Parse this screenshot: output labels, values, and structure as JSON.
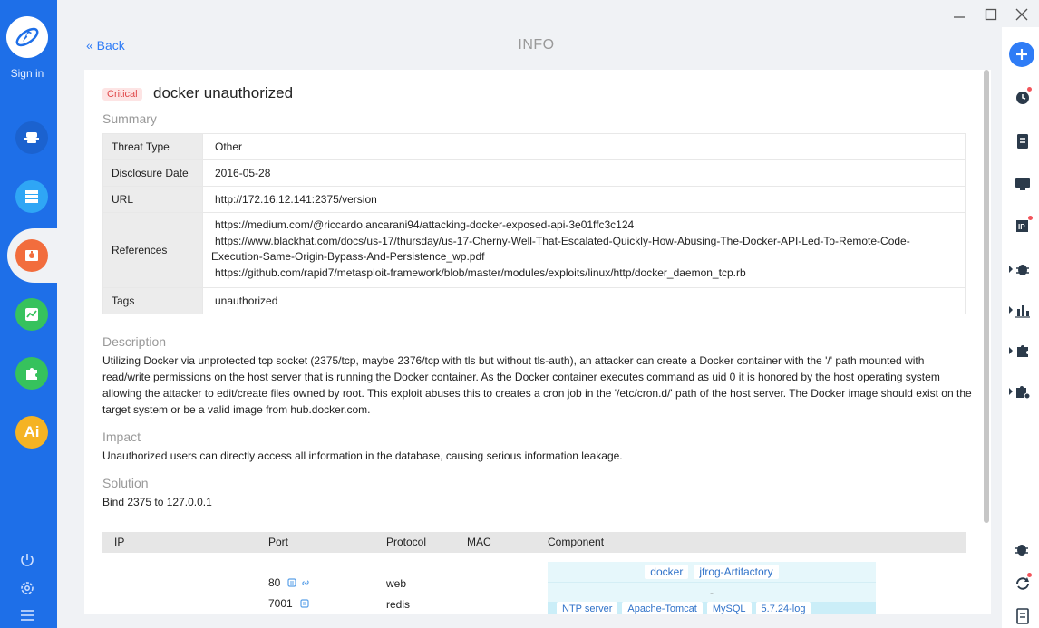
{
  "app": {
    "sign_in": "Sign in",
    "page_title": "INFO",
    "back_label": "« Back"
  },
  "colors": {
    "sidebar": "#1e6fe8",
    "accent": "#2f7cf6",
    "critical_text": "#e0484a",
    "critical_bg": "#fde4e4"
  },
  "sidebar": {
    "items": [
      {
        "icon": "hacker-icon",
        "color": "#1b62cf"
      },
      {
        "icon": "server-list-icon",
        "color": "#2fa6f5"
      },
      {
        "icon": "bug-report-icon",
        "color": "#f26d3d"
      },
      {
        "icon": "trend-chart-icon",
        "color": "#36c25d"
      },
      {
        "icon": "puzzle-icon",
        "color": "#36c25d"
      },
      {
        "icon": "ai-icon",
        "color": "#f5b324",
        "label": "Ai"
      }
    ],
    "bottom": [
      "power-icon",
      "settings-icon",
      "menu-icon"
    ]
  },
  "vuln": {
    "severity": "Critical",
    "title": "docker unauthorized",
    "summary_heading": "Summary",
    "fields": {
      "threat_type_label": "Threat Type",
      "threat_type": "Other",
      "disclosure_label": "Disclosure Date",
      "disclosure": "2016-05-28",
      "url_label": "URL",
      "url": "http://172.16.12.141:2375/version",
      "refs_label": "References",
      "ref1": "https://medium.com/@riccardo.ancarani94/attacking-docker-exposed-api-3e01ffc3c124",
      "ref2a": "https://www.blackhat.com/docs/us-17/thursday/us-17-Cherny-Well-That-Escalated-Quickly-How-Abusing-The-Docker-API-Led-To-Remote-Code-",
      "ref2b": "Execution-Same-Origin-Bypass-And-Persistence_wp.pdf",
      "ref3": "https://github.com/rapid7/metasploit-framework/blob/master/modules/exploits/linux/http/docker_daemon_tcp.rb",
      "tags_label": "Tags",
      "tags": "unauthorized"
    },
    "description_heading": "Description",
    "description": "Utilizing Docker via unprotected tcp socket (2375/tcp, maybe 2376/tcp with tls but without tls-auth), an attacker can create a Docker container with the '/' path mounted with read/write permissions on the host server that is running the Docker container. As the Docker container executes command as uid 0 it is honored by the host operating system allowing the attacker to edit/create files owned by root. This exploit abuses this to creates a cron job in the '/etc/cron.d/' path of the host server. The Docker image should exist on the target system or be a valid image from hub.docker.com.",
    "impact_heading": "Impact",
    "impact": "Unauthorized users can directly access all information in the database, causing serious information leakage.",
    "solution_heading": "Solution",
    "solution": "Bind 2375 to 127.0.0.1"
  },
  "assets": {
    "columns": [
      "IP",
      "Port",
      "Protocol",
      "MAC",
      "Component"
    ],
    "rows": [
      {
        "port": "80",
        "protocol": "web"
      },
      {
        "port": "7001",
        "protocol": "redis"
      }
    ],
    "components_row1": [
      "docker",
      "jfrog-Artifactory"
    ],
    "components_row2": "-",
    "components_row3": [
      "NTP server",
      "Apache-Tomcat",
      "MySQL",
      "5.7.24-log"
    ]
  }
}
